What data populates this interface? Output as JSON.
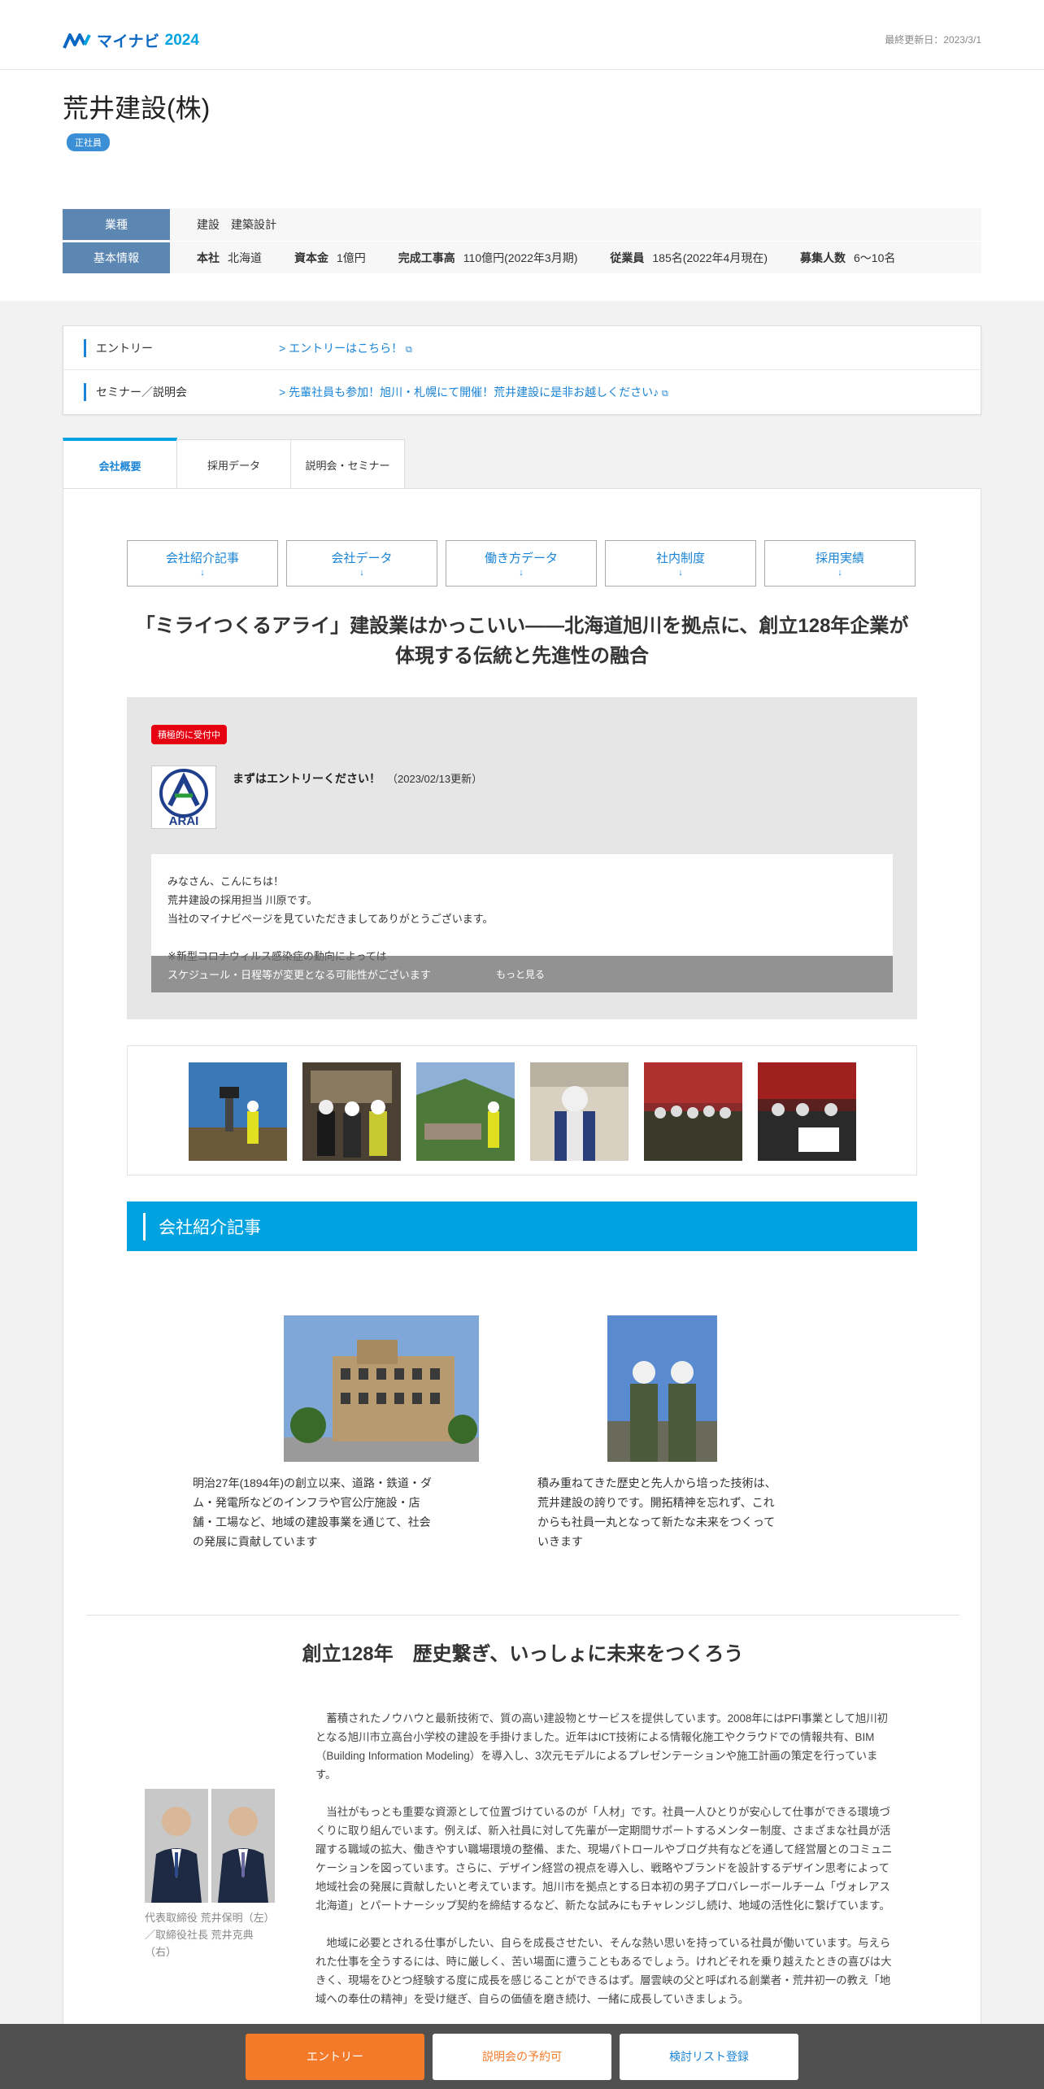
{
  "header": {
    "logo_text": "マイナビ",
    "logo_year": "2024",
    "updated": "最終更新日：2023/3/1"
  },
  "company": {
    "name": "荒井建設(株)",
    "employment_badge": "正社員",
    "industry_label": "業種",
    "industry_value": "建設　建築設計",
    "basic_label": "基本情報",
    "basic": [
      {
        "k": "本社",
        "v": "北海道"
      },
      {
        "k": "資本金",
        "v": "1億円"
      },
      {
        "k": "完成工事高",
        "v": "110億円(2022年3月期)"
      },
      {
        "k": "従業員",
        "v": "185名(2022年4月現在)"
      },
      {
        "k": "募集人数",
        "v": "6～10名"
      }
    ]
  },
  "entry": {
    "rows": [
      {
        "label": "エントリー",
        "link": "エントリーはこちら！"
      },
      {
        "label": "セミナー／説明会",
        "link": "先輩社員も参加！旭川・札幌にて開催！荒井建設に是非お越しください♪"
      }
    ]
  },
  "tabs": [
    "会社概要",
    "採用データ",
    "説明会・セミナー"
  ],
  "subnav": [
    "会社紹介記事",
    "会社データ",
    "働き方データ",
    "社内制度",
    "採用実績"
  ],
  "headline": "「ミライつくるアライ」建設業はかっこいい――北海道旭川を拠点に、創立128年企業が体現する伝統と先進性の融合",
  "message": {
    "tag": "積極的に受付中",
    "logo_letters": "ARAI",
    "title": "まずはエントリーください！",
    "date": "（2023/02/13更新）",
    "lines": [
      "みなさん、こんにちは！",
      "荒井建設の採用担当 川原です。",
      "当社のマイナビページを見ていただきましてありがとうございます。",
      "",
      "※新型コロナウィルス感染症の動向によっては"
    ],
    "overlay_text": "スケジュール・日程等が変更となる可能性がございます",
    "more": "もっと見る"
  },
  "section_title": "会社紹介記事",
  "intro": {
    "left": "明治27年(1894年)の創立以来、道路・鉄道・ダム・発電所などのインフラや官公庁施設・店舗・工場など、地域の建設事業を通じて、社会の発展に貢献しています",
    "right": "積み重ねてきた歴史と先人から培った技術は、荒井建設の誇りです。開拓精神を忘れず、これからも社員一丸となって新たな未来をつくっていきます"
  },
  "subhead": "創立128年　歴史繋ぎ、いっしょに未来をつくろう",
  "body": [
    "蓄積されたノウハウと最新技術で、質の高い建設物とサービスを提供しています。2008年にはPFI事業として旭川初となる旭川市立高台小学校の建設を手掛けました。近年はICT技術による情報化施工やクラウドでの情報共有、BIM（Building Information Modeling）を導入し、3次元モデルによるプレゼンテーションや施工計画の策定を行っています。",
    "当社がもっとも重要な資源として位置づけているのが「人材」です。社員一人ひとりが安心して仕事ができる環境づくりに取り組んでいます。例えば、新入社員に対して先輩が一定期間サポートするメンター制度、さまざまな社員が活躍する職域の拡大、働きやすい職場環境の整備、また、現場パトロールやブログ共有などを通して経営層とのコミュニケーションを図っています。さらに、デザイン経営の視点を導入し、戦略やブランドを設計するデザイン思考によって地域社会の発展に貢献したいと考えています。旭川市を拠点とする日本初の男子プロバレーボールチーム「ヴォレアス北海道」とパートナーシップ契約を締結するなど、新たな試みにもチャレンジし続け、地域の活性化に繋げています。",
    "地域に必要とされる仕事がしたい、自らを成長させたい、そんな熱い思いを持っている社員が働いています。与えられた仕事を全うするには、時に厳しく、苦い場面に遭うこともあるでしょう。けれどそれを乗り越えたときの喜びは大きく、現場をひとつ経験する度に成長を感じることができるはず。層雲峡の父と呼ばれる創業者・荒井初一の教え「地域への奉仕の精神」を受け継ぎ、自らの価値を磨き続け、一緒に成長していきましょう。"
  ],
  "ceo_caption": "代表取締役 荒井保明（左）／取締役社長 荒井克典（右）",
  "bottom": {
    "entry": "エントリー",
    "seminar": "説明会の予約可",
    "list": "検討リスト登録"
  }
}
